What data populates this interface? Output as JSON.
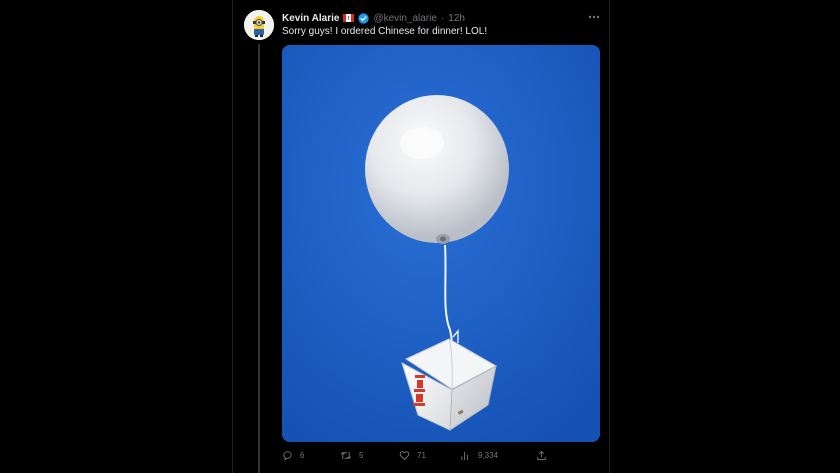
{
  "tweet": {
    "author": {
      "display_name": "Kevin Alarie",
      "handle": "@kevin_alarie",
      "avatar_icon": "minion-avatar-icon",
      "flag_icon": "canada-flag-icon",
      "verified_icon": "verified-badge-icon"
    },
    "separator": "·",
    "timestamp": "12h",
    "text": "Sorry guys! I ordered Chinese for dinner! LOL!",
    "media": {
      "subject_icons": [
        "balloon-icon",
        "takeout-box-icon"
      ]
    },
    "actions": {
      "replies": "6",
      "retweets": "5",
      "likes": "71",
      "views": "9,334"
    }
  },
  "colors": {
    "background": "#000000",
    "text_primary": "#e7e9ea",
    "text_secondary": "#71767b",
    "verified_blue": "#1d9bf0",
    "sky_blue": "#1f5fc4"
  }
}
